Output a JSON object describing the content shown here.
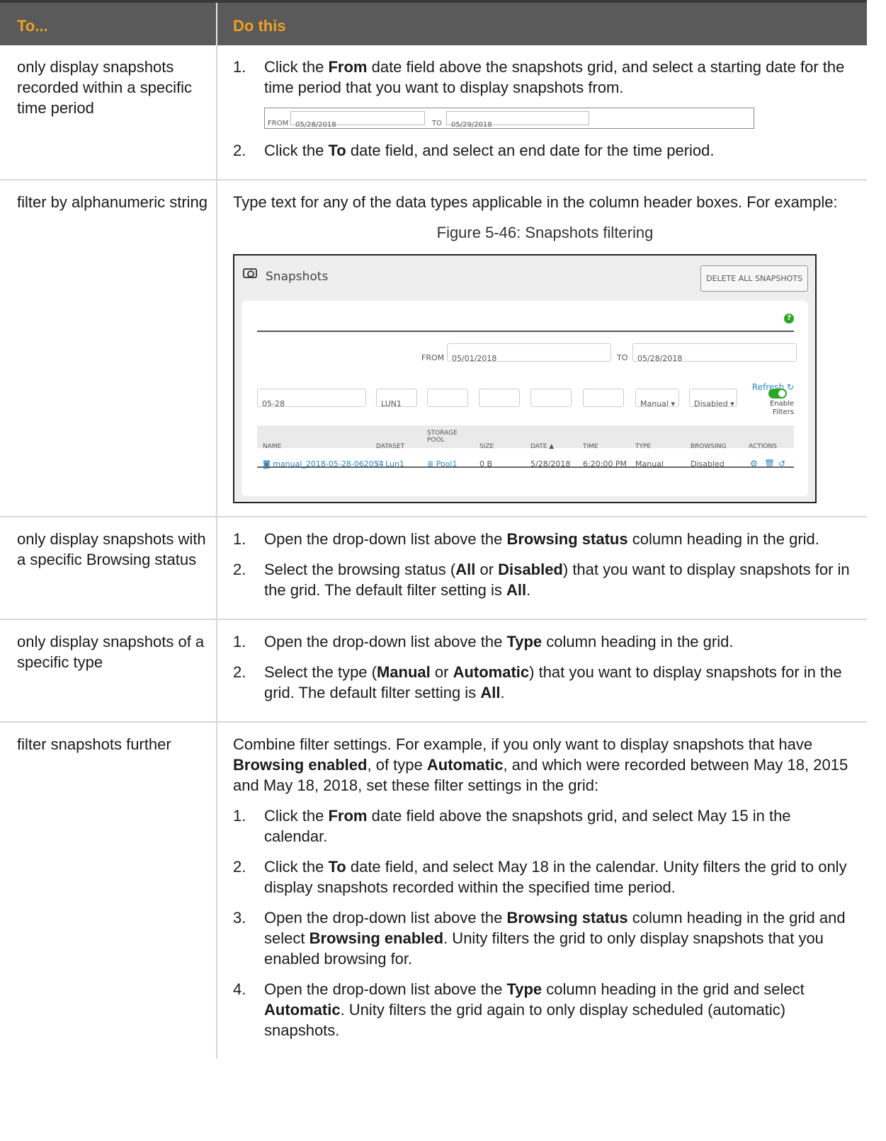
{
  "header": {
    "col1": "To...",
    "col2": "Do this"
  },
  "rows": [
    {
      "task": "only display snapshots recorded within a specific time period",
      "step1_a": "Click the ",
      "step1_b": "From",
      "step1_c": " date field above the snapshots grid, and select a starting date for the time period that you want to display snapshots from.",
      "datebar": {
        "from_label": "FROM",
        "from_value": "05/28/2018",
        "to_label": "TO",
        "to_value": "05/29/2018"
      },
      "step2_a": "Click the ",
      "step2_b": "To",
      "step2_c": " date field, and select an end date for the time period."
    },
    {
      "task": "filter by alphanumeric string",
      "intro": "Type text for any of the data types applicable in the column header boxes. For example:",
      "caption": "Figure 5-46: Snapshots filtering"
    },
    {
      "task": "only display snapshots with a specific Browsing status",
      "step1_a": "Open the drop-down list above the ",
      "step1_b": "Browsing status",
      "step1_c": " column heading in the grid.",
      "step2_a": "Select the browsing status (",
      "step2_b": "All",
      "step2_c": " or ",
      "step2_d": "Disabled",
      "step2_e": ") that you want to display snapshots for in the grid. The default filter setting is ",
      "step2_f": "All",
      "step2_g": "."
    },
    {
      "task": "only display snapshots of a specific type",
      "step1_a": "Open the drop-down list above the ",
      "step1_b": "Type",
      "step1_c": " column heading in the grid.",
      "step2_a": "Select the type (",
      "step2_b": "Manual",
      "step2_c": " or ",
      "step2_d": "Automatic",
      "step2_e": ") that you want to display snapshots for in the grid. The default filter setting is ",
      "step2_f": "All",
      "step2_g": "."
    },
    {
      "task": "filter snapshots further",
      "intro_a": "Combine filter settings. For example, if you only want to display snapshots that have ",
      "intro_b": "Browsing enabled",
      "intro_c": ", of type ",
      "intro_d": "Automatic",
      "intro_e": ", and which were recorded between May 18, 2015 and May 18, 2018, set these filter settings in the grid:",
      "s1_a": "Click the ",
      "s1_b": "From",
      "s1_c": " date field above the snapshots grid, and select May 15 in the calendar.",
      "s2_a": "Click the ",
      "s2_b": "To",
      "s2_c": " date field, and select May 18 in the calendar. Unity filters the grid to only display snapshots recorded within the specified time period.",
      "s3_a": "Open the drop-down list above the ",
      "s3_b": "Browsing status",
      "s3_c": " column heading in the grid and select ",
      "s3_d": "Browsing enabled",
      "s3_e": ". Unity filters the grid to only display snapshots that you enabled browsing for.",
      "s4_a": "Open the drop-down list above the ",
      "s4_b": "Type",
      "s4_c": " column heading in the grid and select ",
      "s4_d": "Automatic",
      "s4_e": ". Unity filters the grid again to only display scheduled (automatic) snapshots."
    }
  ],
  "step_numbers": [
    "1.",
    "2.",
    "3.",
    "4."
  ],
  "snapshots_panel": {
    "title": "Snapshots",
    "delete_all": "DELETE ALL SNAPSHOTS",
    "help": "?",
    "from_label": "FROM",
    "from_value": "05/01/2018",
    "to_label": "TO",
    "to_value": "05/28/2018",
    "refresh": "Refresh",
    "enable_filters": "Enable\nFilters",
    "filters": {
      "name": "05-28",
      "dataset": "LUN1",
      "type": "Manual",
      "browsing": "Disabled"
    },
    "columns": [
      "NAME",
      "DATASET",
      "STORAGE POOL",
      "SIZE",
      "DATE",
      "TIME",
      "TYPE",
      "BROWSING",
      "ACTIONS"
    ],
    "row": {
      "name": "manual_2018-05-28-062054",
      "dataset": "Lun1",
      "pool": "Pool1",
      "size": "0 B",
      "date": "5/28/2018",
      "time": "6:20:00 PM",
      "type": "Manual",
      "browsing": "Disabled"
    },
    "accent": "#2f86c9"
  }
}
